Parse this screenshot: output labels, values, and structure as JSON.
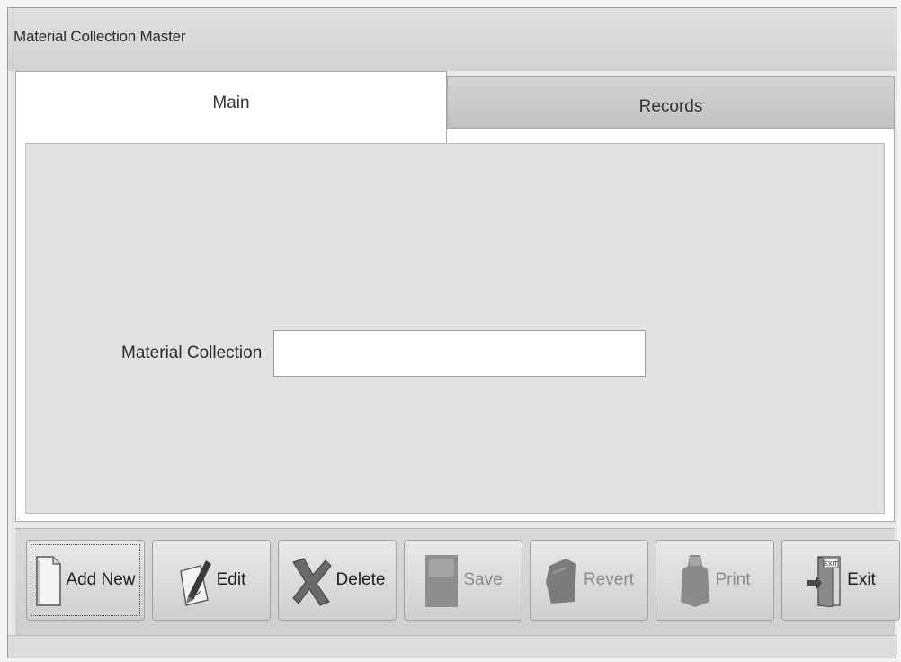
{
  "window": {
    "title": "Material Collection Master"
  },
  "tabs": [
    {
      "label": "Main",
      "active": true
    },
    {
      "label": "Records",
      "active": false
    }
  ],
  "form": {
    "material_collection_label": "Material Collection",
    "material_collection_value": "",
    "material_collection_placeholder": ""
  },
  "toolbar": {
    "add_new_label": "Add New",
    "edit_label": "Edit",
    "delete_label": "Delete",
    "save_label": "Save",
    "revert_label": "Revert",
    "print_label": "Print",
    "exit_label": "Exit"
  },
  "icons": {
    "add_new": "new-document-icon",
    "edit": "pen-paper-icon",
    "delete": "delete-x-icon",
    "save": "save-disk-icon",
    "revert": "revert-icon",
    "print": "printer-icon",
    "exit": "exit-door-icon"
  },
  "colors": {
    "window_bg": "#e9e9e9",
    "panel_bg": "#e2e2e2",
    "tab_active_bg": "#ffffff",
    "tab_inactive_bg": "#c8c8c8"
  }
}
